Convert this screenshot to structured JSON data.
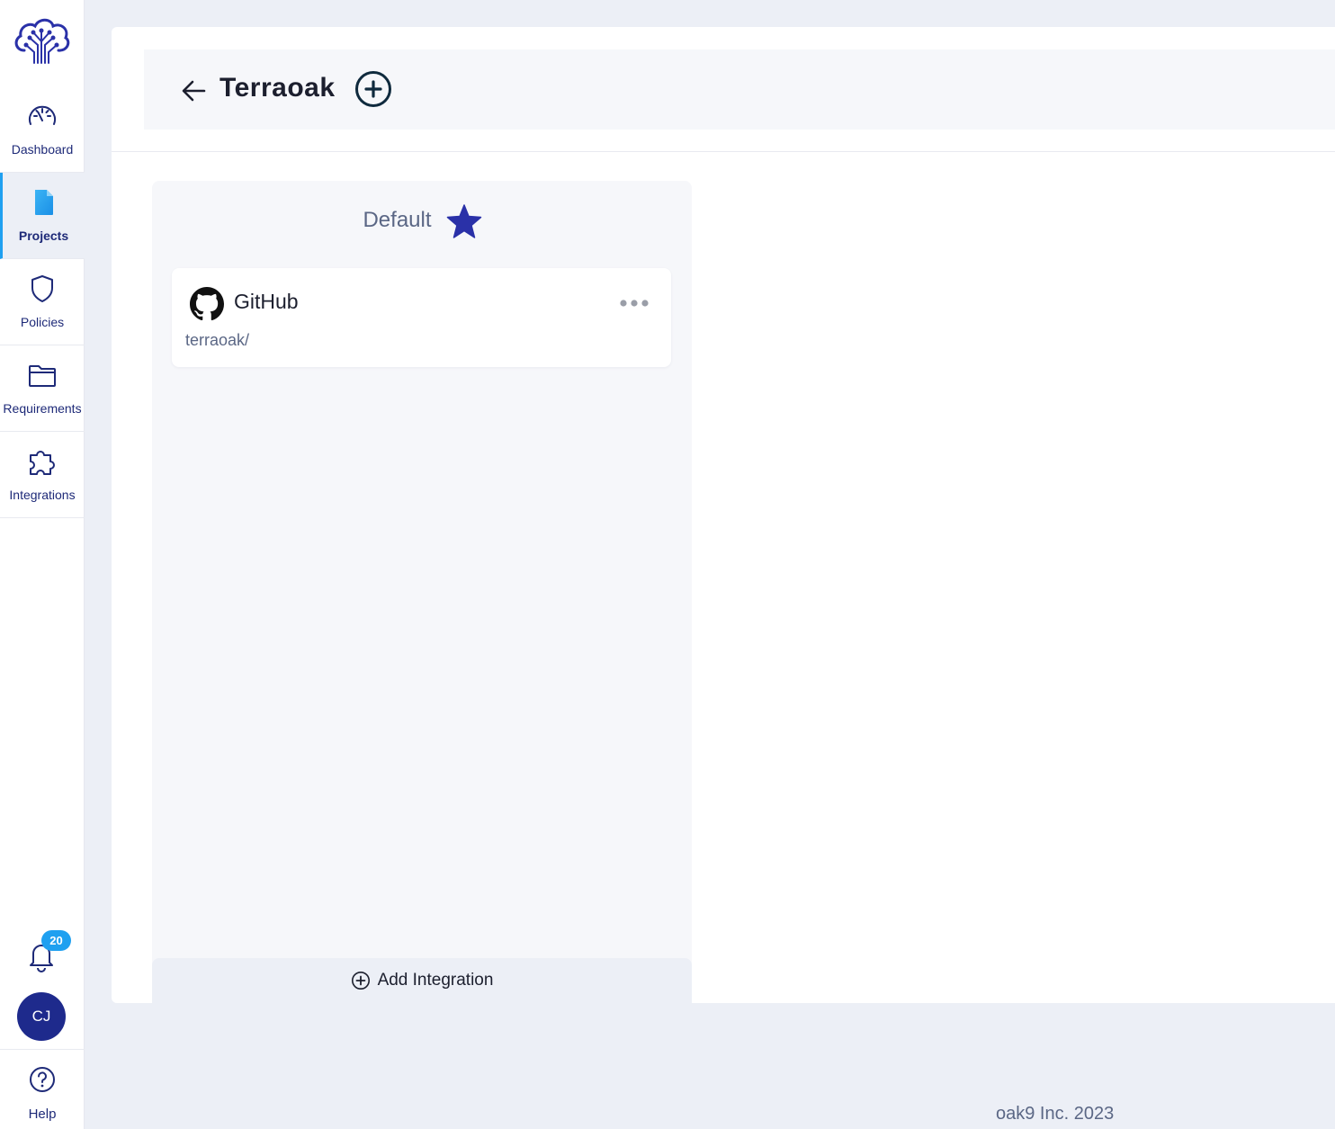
{
  "sidebar": {
    "items": [
      {
        "label": "Dashboard",
        "icon": "speedometer-icon"
      },
      {
        "label": "Projects",
        "icon": "document-icon",
        "active": true
      },
      {
        "label": "Policies",
        "icon": "shield-icon"
      },
      {
        "label": "Requirements",
        "icon": "folder-icon"
      },
      {
        "label": "Integrations",
        "icon": "puzzle-icon"
      }
    ],
    "notifications_count": "20",
    "avatar_initials": "CJ",
    "help_label": "Help"
  },
  "header": {
    "title": "Terraoak"
  },
  "column": {
    "title": "Default",
    "add_label": "Add Integration"
  },
  "card": {
    "title": "GitHub",
    "subtitle": "terraoak/"
  },
  "footer": {
    "text": "oak9 Inc. 2023"
  },
  "colors": {
    "accent": "#1fa0f0",
    "brand": "#1e2a8c",
    "star": "#2a31a8"
  }
}
